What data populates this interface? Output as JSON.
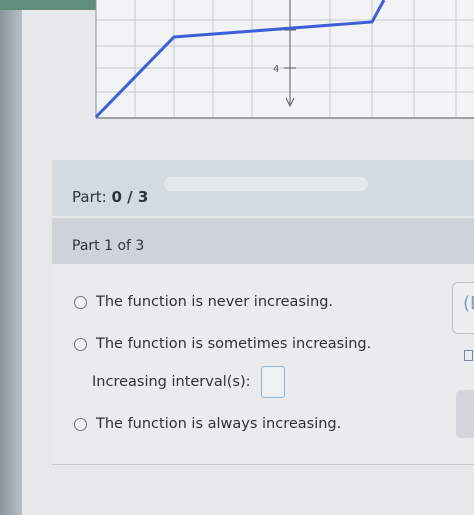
{
  "part_header": {
    "prefix": "Part:",
    "progress": "0 / 3",
    "progress_fraction": 0
  },
  "part1": {
    "title": "Part 1 of 3"
  },
  "options": {
    "never": "The function is never increasing.",
    "sometimes": "The function is sometimes increasing.",
    "interval_label": "Increasing interval(s):",
    "always": "The function is always increasing."
  },
  "graph": {
    "tick_label": "4",
    "line_color": "#3f5fd6",
    "grid_color": "#c6cbd0"
  },
  "side": {
    "glyph": "(E"
  }
}
